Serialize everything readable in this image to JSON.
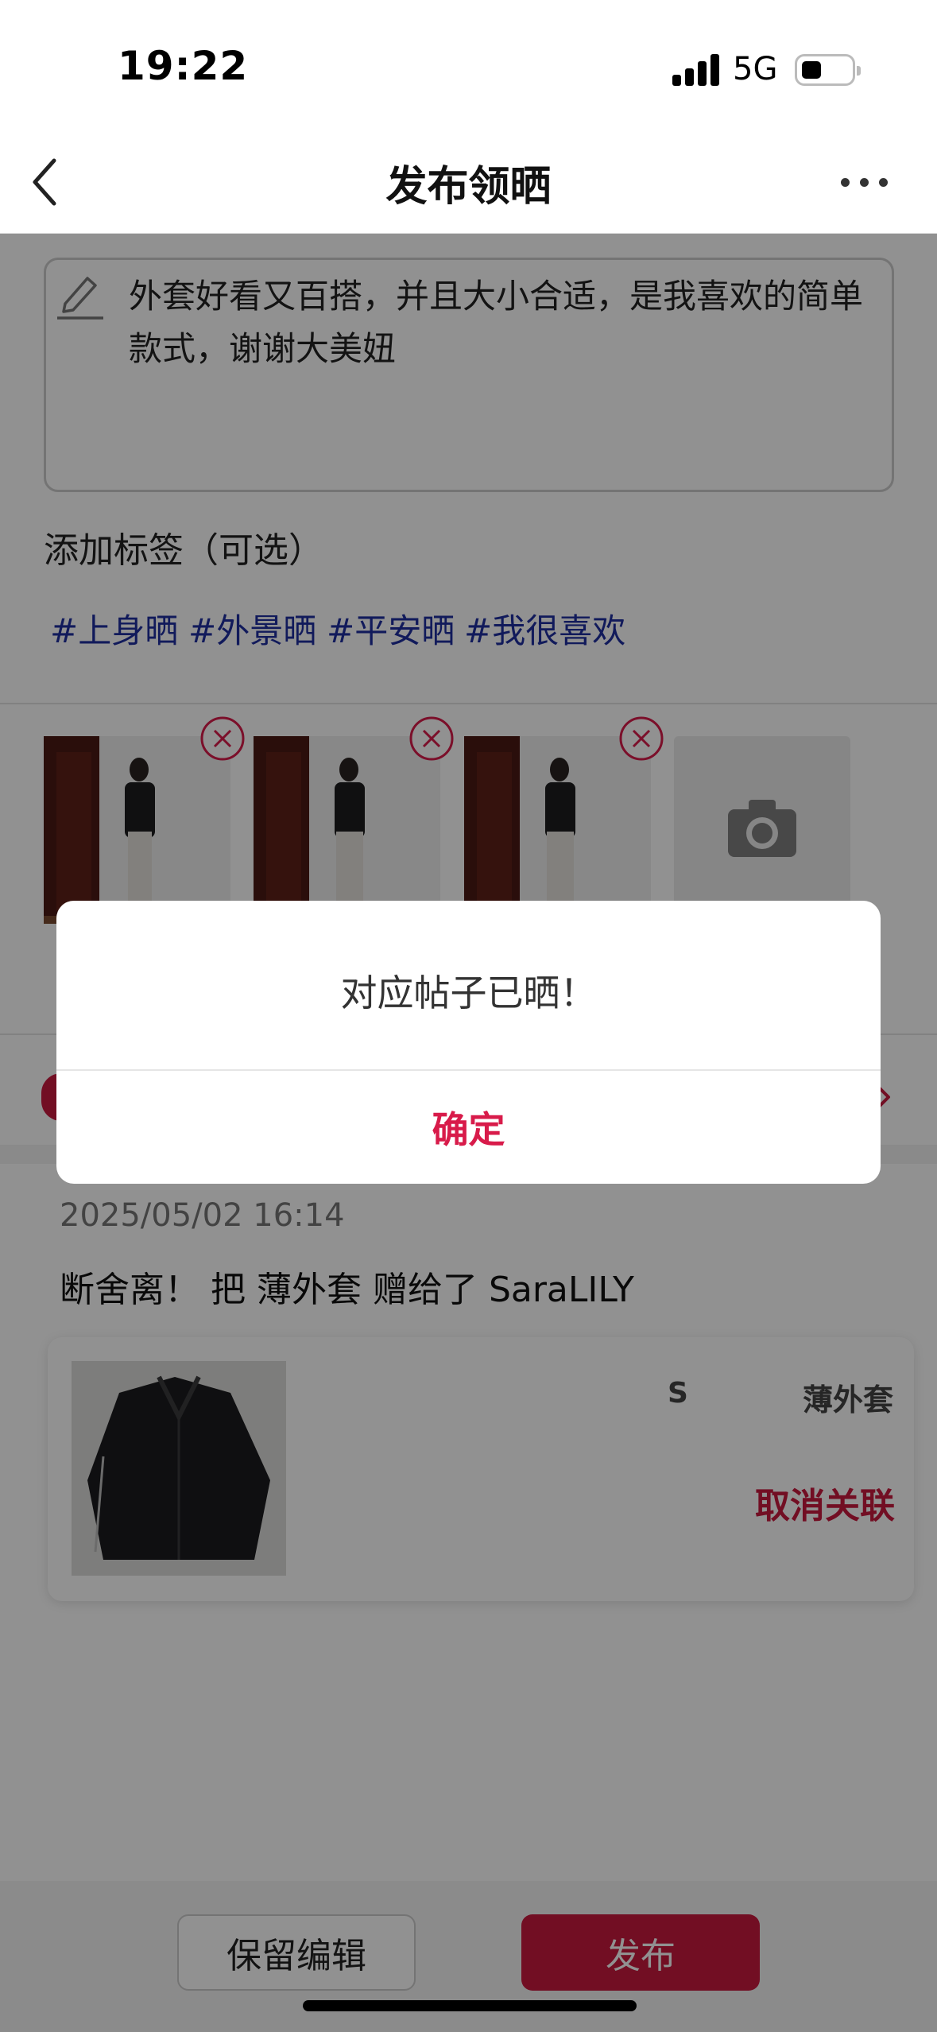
{
  "status_bar": {
    "time": "19:22",
    "network": "5G"
  },
  "nav": {
    "title": "发布领晒",
    "back_icon": "chevron-left-icon",
    "more_icon": "more-horizontal-icon"
  },
  "review": {
    "text": "外套好看又百搭，并且大小合适，是我喜欢的简单款式，谢谢大美妞",
    "icon": "pencil-icon"
  },
  "tags": {
    "label": "添加标签（可选）",
    "items": [
      "#上身晒",
      "#外景晒",
      "#平安晒",
      "#我很喜欢"
    ],
    "color": "#1f2fa0"
  },
  "photos": {
    "count": 3,
    "remove_icon": "close-circle-icon",
    "add_icon": "camera-icon"
  },
  "post": {
    "timestamp": "2025/05/02 16:14",
    "gift_line": "断舍离！ 把 薄外套 赠给了 SaraLILY",
    "item": {
      "size": "S",
      "name": "薄外套",
      "unlink_label": "取消关联"
    }
  },
  "bottom": {
    "keep_edit_label": "保留编辑",
    "publish_label": "发布"
  },
  "dialog": {
    "message": "对应帖子已晒！",
    "confirm_label": "确定"
  },
  "colors": {
    "accent": "#c8193f",
    "dialog_confirm": "#d81b4a",
    "overlay": "rgba(0,0,0,0.43)"
  }
}
